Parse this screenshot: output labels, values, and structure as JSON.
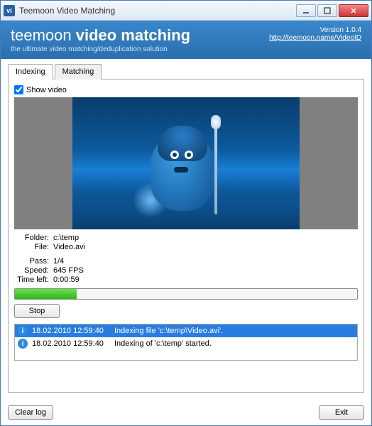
{
  "window": {
    "title": "Teemoon Video Matching"
  },
  "header": {
    "brand_prefix": "teemoon ",
    "brand_bold": "video matching",
    "tagline": "the ultimate video matching/deduplication solution",
    "version": "Version 1.0.4",
    "url": "http://teemoon.name/VideoID"
  },
  "tabs": {
    "indexing": "Indexing",
    "matching": "Matching"
  },
  "show_video_label": "Show video",
  "info": {
    "folder_label": "Folder:",
    "folder_value": "c:\\temp",
    "file_label": "File:",
    "file_value": "Video.avi",
    "pass_label": "Pass:",
    "pass_value": "1/4",
    "speed_label": "Speed:",
    "speed_value": "645 FPS",
    "timeleft_label": "Time left:",
    "timeleft_value": "0:00:59"
  },
  "buttons": {
    "stop": "Stop",
    "clear_log": "Clear log",
    "exit": "Exit"
  },
  "log": [
    {
      "time": "18.02.2010 12:59:40",
      "msg": "Indexing file 'c:\\temp\\Video.avi'."
    },
    {
      "time": "18.02.2010 12:59:40",
      "msg": "Indexing of 'c:\\temp' started."
    }
  ],
  "progress_percent": 18
}
